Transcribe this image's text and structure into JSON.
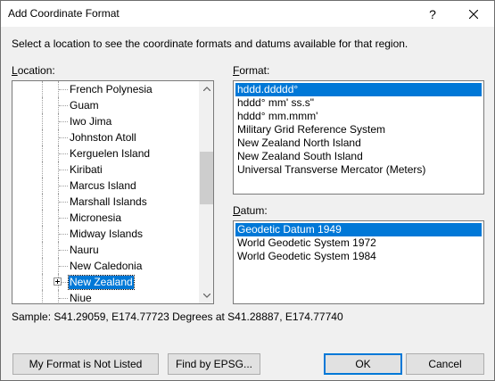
{
  "window": {
    "title": "Add Coordinate Format",
    "help_label": "?"
  },
  "instruction": "Select a location to see the coordinate formats and datums available for that region.",
  "location": {
    "label_accel": "L",
    "label_rest": "ocation:",
    "items": [
      {
        "label": "French Polynesia",
        "selected": false
      },
      {
        "label": "Guam",
        "selected": false
      },
      {
        "label": "Iwo Jima",
        "selected": false
      },
      {
        "label": "Johnston Atoll",
        "selected": false
      },
      {
        "label": "Kerguelen Island",
        "selected": false
      },
      {
        "label": "Kiribati",
        "selected": false
      },
      {
        "label": "Marcus Island",
        "selected": false
      },
      {
        "label": "Marshall Islands",
        "selected": false
      },
      {
        "label": "Micronesia",
        "selected": false
      },
      {
        "label": "Midway Islands",
        "selected": false
      },
      {
        "label": "Nauru",
        "selected": false
      },
      {
        "label": "New Caledonia",
        "selected": false
      },
      {
        "label": "New Zealand",
        "selected": true,
        "expandable": true
      },
      {
        "label": "Niue",
        "selected": false
      }
    ]
  },
  "format": {
    "label_accel": "F",
    "label_rest": "ormat:",
    "items": [
      {
        "label": "hddd.ddddd°",
        "selected": true
      },
      {
        "label": "hddd° mm' ss.s\"",
        "selected": false
      },
      {
        "label": "hddd° mm.mmm'",
        "selected": false
      },
      {
        "label": "Military Grid Reference System",
        "selected": false
      },
      {
        "label": "New Zealand North Island",
        "selected": false
      },
      {
        "label": "New Zealand South Island",
        "selected": false
      },
      {
        "label": "Universal Transverse Mercator (Meters)",
        "selected": false
      }
    ]
  },
  "datum": {
    "label_accel": "D",
    "label_rest": "atum:",
    "items": [
      {
        "label": "Geodetic Datum 1949",
        "selected": true
      },
      {
        "label": "World Geodetic System 1972",
        "selected": false
      },
      {
        "label": "World Geodetic System 1984",
        "selected": false
      }
    ]
  },
  "sample": "Sample: S41.29059, E174.77723 Degrees at S41.28887, E174.77740",
  "buttons": {
    "not_listed": "My Format is Not Listed",
    "find_epsg": "Find by EPSG...",
    "ok": "OK",
    "cancel": "Cancel"
  },
  "colors": {
    "selection": "#0078d7",
    "dialog_bg": "#f0f0f0"
  }
}
